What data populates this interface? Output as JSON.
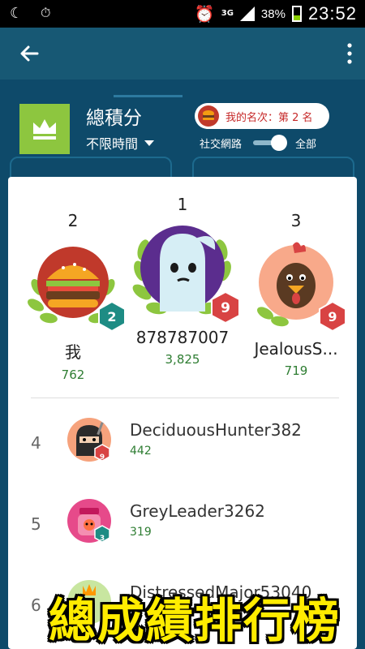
{
  "status_bar": {
    "network": "3G",
    "battery": "38%",
    "time": "23:52"
  },
  "header": {
    "title": "總積分",
    "time_filter": "不限時間",
    "my_rank": "我的名次：第 2 名",
    "toggle_left": "社交網路",
    "toggle_right": "全部"
  },
  "podium": [
    {
      "rank": "2",
      "name": "我",
      "score": "762",
      "level": "2"
    },
    {
      "rank": "1",
      "name": "878787007",
      "score": "3,825",
      "level": "9"
    },
    {
      "rank": "3",
      "name": "JealousS...",
      "score": "719",
      "level": "9"
    }
  ],
  "list": [
    {
      "rank": "4",
      "name": "DeciduousHunter382",
      "score": "442",
      "level": "9"
    },
    {
      "rank": "5",
      "name": "GreyLeader3262",
      "score": "319",
      "level": "3"
    },
    {
      "rank": "6",
      "name": "DistressedMajor53040",
      "score": ""
    }
  ],
  "caption": "總成績排行榜",
  "colors": {
    "app_bar": "#175874",
    "header_bg": "#0e4a6a",
    "score_green": "#2e7d32",
    "level_red": "#d84343",
    "level_teal": "#1e8c84",
    "caption_yellow": "#ffec00"
  }
}
